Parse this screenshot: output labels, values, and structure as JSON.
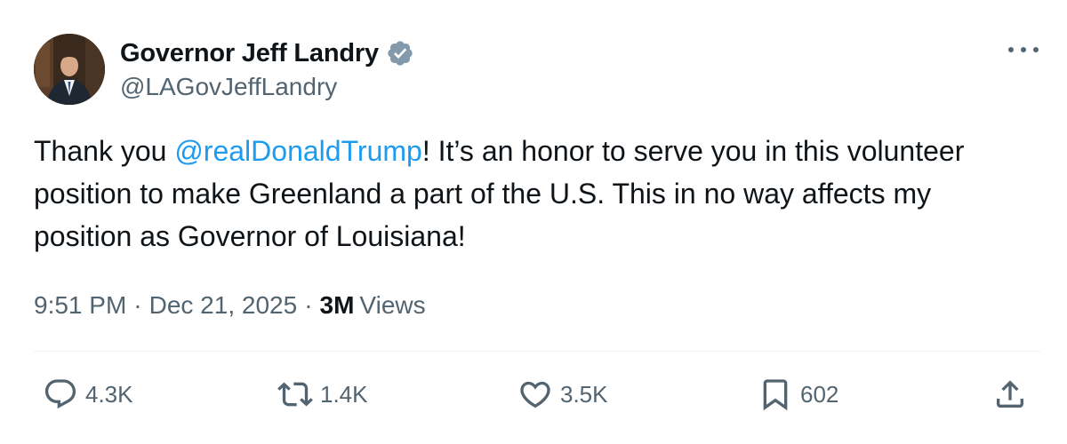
{
  "author": {
    "display_name": "Governor Jeff Landry",
    "handle": "@LAGovJeffLandry",
    "verified": true,
    "verified_color": "#829aab"
  },
  "tweet": {
    "text_before": "Thank you ",
    "mention": "@realDonaldTrump",
    "text_after": "! It’s an honor to serve you in this volunteer position to make Greenland a part of the U.S. This in no way affects my position as Governor of Louisiana!",
    "time": "9:51 PM",
    "separator": "·",
    "date": "Dec 21, 2025",
    "views_count": "3M",
    "views_label": "Views"
  },
  "actions": {
    "replies": "4.3K",
    "reposts": "1.4K",
    "likes": "3.5K",
    "bookmarks": "602"
  },
  "icons": {
    "more": "more-horizontal-icon",
    "reply": "reply-icon",
    "repost": "repost-icon",
    "like": "heart-icon",
    "bookmark": "bookmark-icon",
    "share": "share-icon"
  },
  "colors": {
    "text": "#0f1419",
    "secondary": "#536471",
    "link": "#1d9bf0",
    "divider": "#eff3f4"
  }
}
